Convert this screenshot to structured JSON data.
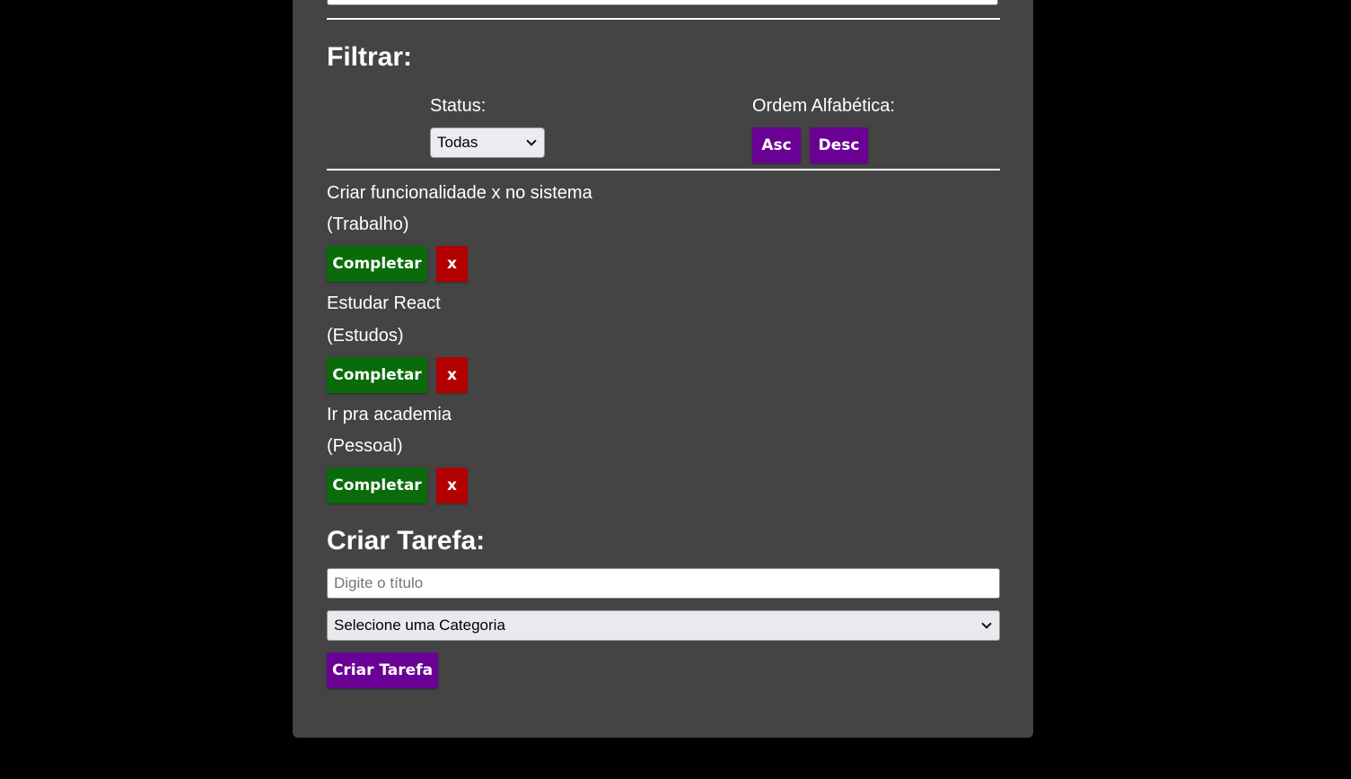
{
  "filter": {
    "heading": "Filtrar:",
    "status_label": "Status:",
    "status_selected": "Todas",
    "order_label": "Ordem Alfabética:",
    "asc_label": "Asc",
    "desc_label": "Desc"
  },
  "tasks": [
    {
      "title": "Criar funcionalidade x no sistema",
      "category": "(Trabalho)",
      "complete_label": "Completar",
      "delete_label": "x"
    },
    {
      "title": "Estudar React",
      "category": "(Estudos)",
      "complete_label": "Completar",
      "delete_label": "x"
    },
    {
      "title": "Ir pra academia",
      "category": "(Pessoal)",
      "complete_label": "Completar",
      "delete_label": "x"
    }
  ],
  "create": {
    "heading": "Criar Tarefa:",
    "title_placeholder": "Digite o título",
    "category_selected": "Selecione uma Categoria",
    "submit_label": "Criar Tarefa"
  },
  "colors": {
    "background": "#000000",
    "panel": "#444444",
    "accent_purple": "#6a0094",
    "complete_green": "#0a6b0a",
    "delete_red": "#b30000"
  }
}
